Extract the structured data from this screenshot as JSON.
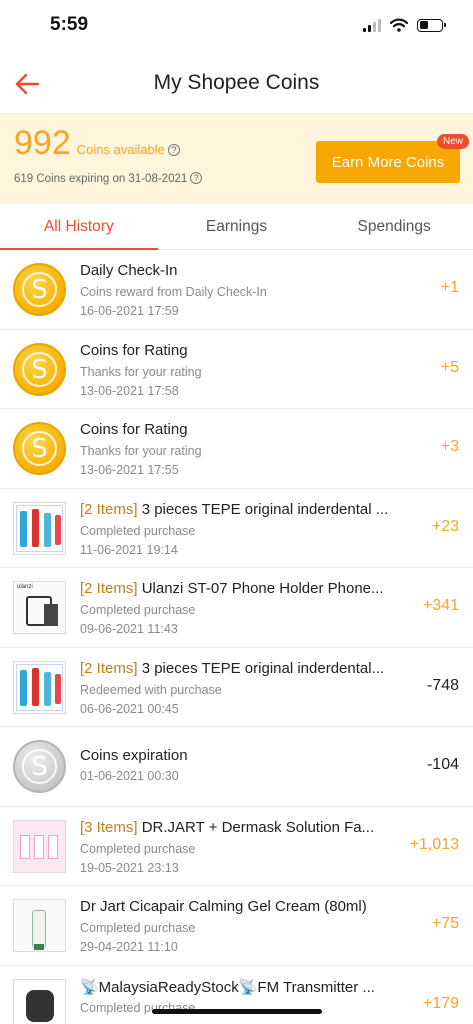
{
  "status_bar": {
    "time": "5:59"
  },
  "header": {
    "title": "My Shopee Coins"
  },
  "coins": {
    "amount": "992",
    "available_label": "Coins available",
    "expiring_text": "619 Coins expiring on 31-08-2021",
    "earn_button": "Earn More Coins",
    "new_badge": "New",
    "accent_color": "#f5a623"
  },
  "tabs": [
    {
      "label": "All History",
      "active": true
    },
    {
      "label": "Earnings",
      "active": false
    },
    {
      "label": "Spendings",
      "active": false
    }
  ],
  "history": [
    {
      "icon": "gold-coin-icon",
      "tag": "",
      "title": "Daily Check-In",
      "subtitle": "Coins reward from Daily Check-In",
      "date": "16-06-2021 17:59",
      "amount": "+1"
    },
    {
      "icon": "gold-coin-icon",
      "tag": "",
      "title": "Coins for Rating",
      "subtitle": "Thanks for your rating",
      "date": "13-06-2021 17:58",
      "amount": "+5"
    },
    {
      "icon": "gold-coin-icon",
      "tag": "",
      "title": "Coins for Rating",
      "subtitle": "Thanks for your rating",
      "date": "13-06-2021 17:55",
      "amount": "+3"
    },
    {
      "icon": "interdental-brush-product-icon",
      "tag": "[2 Items]",
      "title": " 3 pieces TEPE original inderdental ...",
      "subtitle": "Completed purchase",
      "date": "11-06-2021 19:14",
      "amount": "+23"
    },
    {
      "icon": "phone-holder-product-icon",
      "tag": "[2 Items]",
      "title": " Ulanzi ST-07 Phone Holder Phone...",
      "subtitle": "Completed purchase",
      "date": "09-06-2021 11:43",
      "amount": "+341"
    },
    {
      "icon": "interdental-brush-product-icon",
      "tag": "[2 Items]",
      "title": " 3 pieces TEPE original inderdental...",
      "subtitle": "Redeemed with purchase",
      "date": "06-06-2021 00:45",
      "amount": "-748"
    },
    {
      "icon": "silver-coin-icon",
      "tag": "",
      "title": "Coins expiration",
      "subtitle": "",
      "date": "01-06-2021 00:30",
      "amount": "-104"
    },
    {
      "icon": "dermask-product-icon",
      "tag": "[3 Items]",
      "title": " DR.JART + Dermask Solution Fa...",
      "subtitle": "Completed purchase",
      "date": "19-05-2021 23:13",
      "amount": "+1,013"
    },
    {
      "icon": "cream-product-icon",
      "tag": "",
      "title": "Dr Jart Cicapair Calming Gel Cream (80ml)",
      "subtitle": "Completed purchase",
      "date": "29-04-2021 11:10",
      "amount": "+75"
    },
    {
      "icon": "fm-transmitter-product-icon",
      "tag": "",
      "title": "📡MalaysiaReadyStock📡FM Transmitter ...",
      "subtitle": "Completed purchase",
      "date": "",
      "amount": "+179"
    }
  ]
}
